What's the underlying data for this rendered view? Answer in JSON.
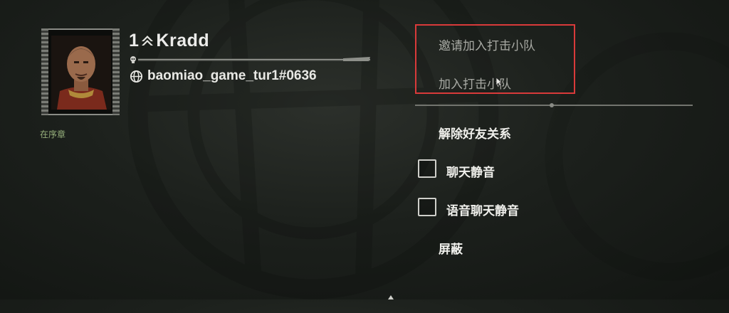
{
  "player": {
    "rank": "1",
    "name": "Kradd",
    "id": "baomiao_game_tur1#0636",
    "chapter": "在序章"
  },
  "menu": {
    "invite_squad": "邀请加入打击小队",
    "join_squad": "加入打击小队",
    "remove_friend": "解除好友关系",
    "mute_chat": "聊天静音",
    "mute_voice": "语音聊天静音",
    "block": "屏蔽"
  },
  "colors": {
    "highlight": "#d93a3a",
    "chapter_text": "#97b07c"
  },
  "icons": [
    "rank-chevron-icon",
    "globe-icon",
    "skull-icon",
    "mouse-cursor-icon"
  ]
}
